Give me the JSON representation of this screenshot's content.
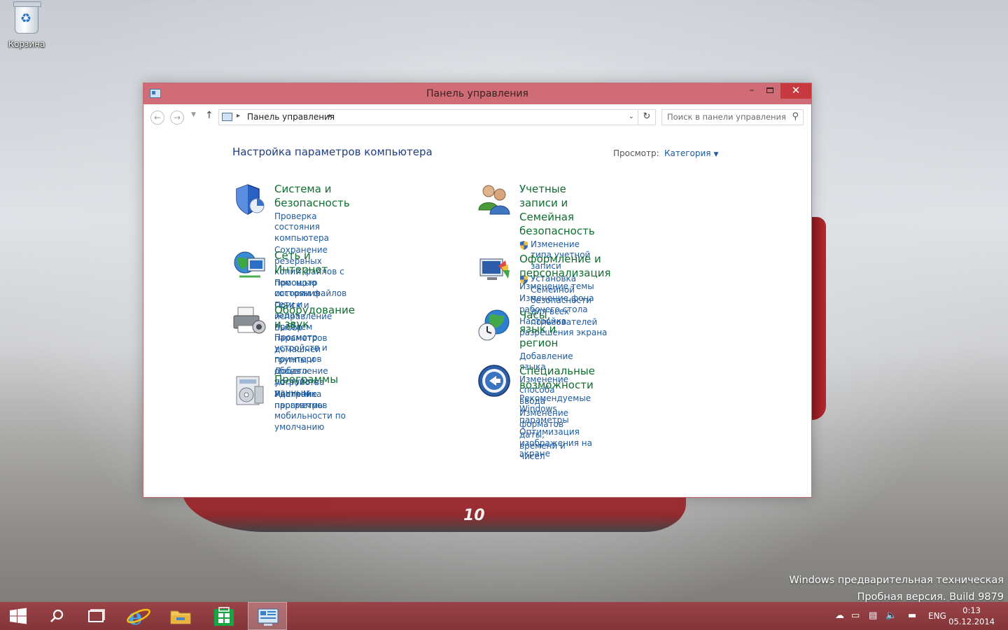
{
  "desktop": {
    "recycle_bin_label": "Корзина",
    "car_number": "10",
    "watermark_line1": "Windows предварительная техническая",
    "watermark_line2": "Пробная версия. Build 9879"
  },
  "window": {
    "title": "Панель управления",
    "controls": {
      "minimize": "–",
      "close": "✕"
    }
  },
  "addressbar": {
    "breadcrumb": "Панель управления",
    "search_placeholder": "Поиск в панели управления"
  },
  "main": {
    "heading": "Настройка параметров компьютера",
    "view_label": "Просмотр:",
    "view_value": "Категория",
    "categories_left": [
      {
        "icon": "shield-icon",
        "title": "Система и безопасность",
        "links": [
          "Проверка состояния компьютера",
          "Сохранение резервных копий файлов с помощью",
          "истории файлов",
          "Поиск и исправление проблем"
        ]
      },
      {
        "icon": "network-globe-icon",
        "title": "Сеть и Интернет",
        "links": [
          "Просмотр состояния сети и задач",
          "Выбор параметров домашней группы и общего",
          "доступа к данным"
        ]
      },
      {
        "icon": "printer-icon",
        "title": "Оборудование и звук",
        "links": [
          "Просмотр устройств и принтеров",
          "Добавление устройства",
          "Настройка параметров мобильности по",
          "умолчанию"
        ]
      },
      {
        "icon": "programs-icon",
        "title": "Программы",
        "links": [
          "Удаление программы"
        ]
      }
    ],
    "categories_right": [
      {
        "icon": "users-icon",
        "title_line1": "Учетные записи и Семейная",
        "title_line2": "безопасность",
        "links": [
          "Изменение типа учетной записи",
          "Установка Семейной безопасности для всех",
          "пользователей"
        ]
      },
      {
        "icon": "personalization-icon",
        "title": "Оформление и персонализация",
        "links": [
          "Изменение темы",
          "Изменение фона рабочего стола",
          "Настройка разрешения экрана"
        ]
      },
      {
        "icon": "clock-globe-icon",
        "title": "Часы, язык и регион",
        "links": [
          "Добавление языка",
          "Изменение способа ввода",
          "Изменение форматов даты, времени и чисел"
        ]
      },
      {
        "icon": "accessibility-icon",
        "title": "Специальные возможности",
        "links": [
          "Рекомендуемые Windows параметры",
          "Оптимизация изображения на экране"
        ]
      }
    ]
  },
  "taskbar": {
    "language": "ENG",
    "time": "0:13",
    "date": "05.12.2014",
    "accent": "#8b3a3f"
  }
}
